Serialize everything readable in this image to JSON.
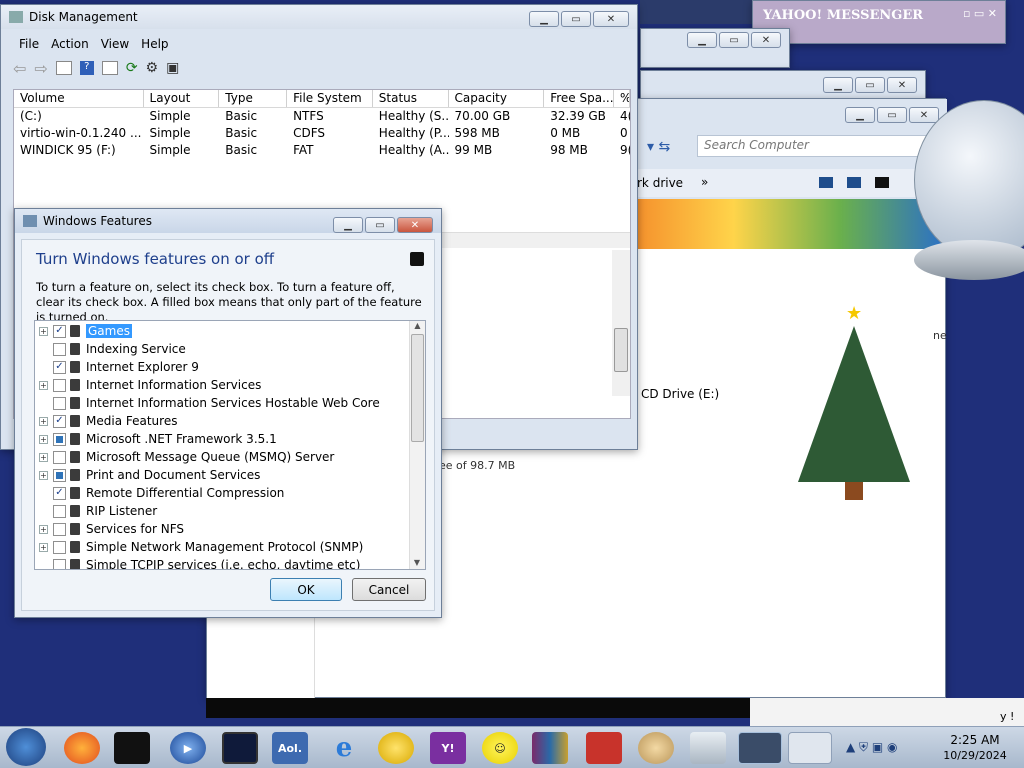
{
  "disk_mgmt": {
    "title": "Disk Management",
    "menu": [
      "File",
      "Action",
      "View",
      "Help"
    ],
    "columns": [
      "Volume",
      "Layout",
      "Type",
      "File System",
      "Status",
      "Capacity",
      "Free Spa...",
      "%"
    ],
    "rows": [
      [
        "(C:)",
        "Simple",
        "Basic",
        "NTFS",
        "Healthy (S...",
        "70.00 GB",
        "32.39 GB",
        "4("
      ],
      [
        "virtio-win-0.1.240 ...",
        "Simple",
        "Basic",
        "CDFS",
        "Healthy (P...",
        "598 MB",
        "0 MB",
        "0"
      ],
      [
        "WINDICK 95 (F:)",
        "Simple",
        "Basic",
        "FAT",
        "Healthy (A...",
        "99 MB",
        "98 MB",
        "9("
      ]
    ]
  },
  "win_features": {
    "title": "Windows Features",
    "heading": "Turn Windows features on or off",
    "description": "To turn a feature on, select its check box. To turn a feature off, clear its check box. A filled box means that only part of the feature is turned on.",
    "items": [
      {
        "label": "Games",
        "state": "checked",
        "expand": true
      },
      {
        "label": "Indexing Service",
        "state": "unchecked",
        "expand": false
      },
      {
        "label": "Internet Explorer 9",
        "state": "checked",
        "expand": false
      },
      {
        "label": "Internet Information Services",
        "state": "unchecked",
        "expand": true
      },
      {
        "label": "Internet Information Services Hostable Web Core",
        "state": "unchecked",
        "expand": false
      },
      {
        "label": "Media Features",
        "state": "checked",
        "expand": true
      },
      {
        "label": "Microsoft .NET Framework 3.5.1",
        "state": "partial",
        "expand": true
      },
      {
        "label": "Microsoft Message Queue (MSMQ) Server",
        "state": "unchecked",
        "expand": true
      },
      {
        "label": "Print and Document Services",
        "state": "partial",
        "expand": true
      },
      {
        "label": "Remote Differential Compression",
        "state": "checked",
        "expand": false
      },
      {
        "label": "RIP Listener",
        "state": "unchecked",
        "expand": false
      },
      {
        "label": "Services for NFS",
        "state": "unchecked",
        "expand": true
      },
      {
        "label": "Simple Network Management Protocol (SNMP)",
        "state": "unchecked",
        "expand": true
      },
      {
        "label": "Simple TCPIP services (i.e. echo, daytime etc)",
        "state": "unchecked",
        "expand": false
      }
    ],
    "ok": "OK",
    "cancel": "Cancel"
  },
  "explorer": {
    "search_placeholder": "Search Computer",
    "nav_text": "rk drive",
    "cd_drive": "CD Drive (E:)",
    "free_text": "ee of 98.7 MB",
    "side_text": "ne"
  },
  "yahoo": {
    "title": "YAHOO! MESSENGER"
  },
  "taskbar": {
    "time": "2:25 AM",
    "date": "10/29/2024",
    "aol": "Aol."
  },
  "colors": {
    "accent": "#1e4d8c",
    "taskbar": "#b8c6d8"
  }
}
